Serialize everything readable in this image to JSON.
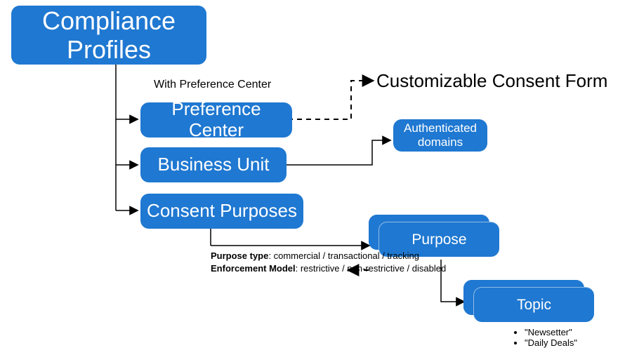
{
  "nodes": {
    "compliance_profiles": "Compliance\nProfiles",
    "preference_center": "Preference Center",
    "business_unit": "Business Unit",
    "consent_purposes": "Consent Purposes",
    "authenticated_domains": "Authenticated\ndomains",
    "purpose": "Purpose",
    "topic": "Topic",
    "consent_form": "Customizable Consent Form"
  },
  "labels": {
    "with_pref_center": "With Preference Center"
  },
  "details": {
    "purpose_type_key": "Purpose type",
    "purpose_type_val": ": commercial / transactional / tracking",
    "enforcement_key": "Enforcement Model",
    "enforcement_val": ": restrictive / non-restrictive / disabled"
  },
  "topics": [
    "\"Newsetter\"",
    "\"Daily Deals\""
  ],
  "colors": {
    "brand": "#1f78d1"
  }
}
